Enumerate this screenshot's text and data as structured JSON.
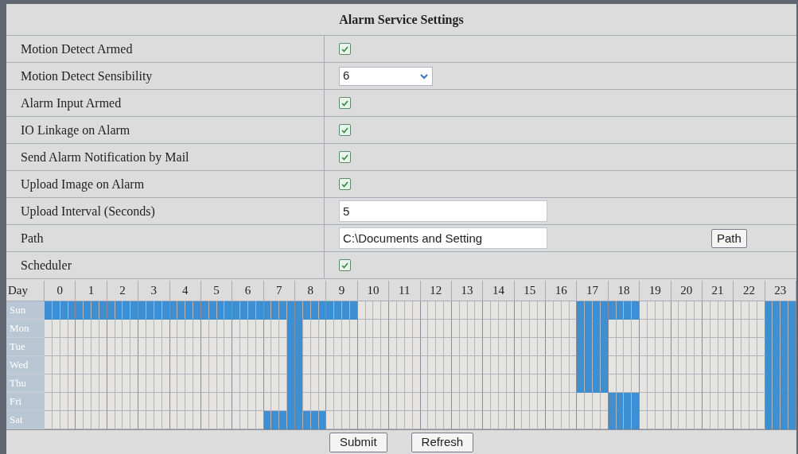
{
  "title": "Alarm Service Settings",
  "settings": [
    {
      "label": "Motion Detect Armed",
      "kind": "checkbox",
      "checked": true
    },
    {
      "label": "Motion Detect Sensibility",
      "kind": "select",
      "value": "6"
    },
    {
      "label": "Alarm Input Armed",
      "kind": "checkbox",
      "checked": true
    },
    {
      "label": "IO Linkage on Alarm",
      "kind": "checkbox",
      "checked": true
    },
    {
      "label": "Send Alarm Notification by Mail",
      "kind": "checkbox",
      "checked": true
    },
    {
      "label": "Upload Image on Alarm",
      "kind": "checkbox",
      "checked": true
    },
    {
      "label": "Upload Interval (Seconds)",
      "kind": "text",
      "value": "5"
    },
    {
      "label": "Path",
      "kind": "path",
      "value": "C:\\Documents and Setting",
      "button": "Path"
    },
    {
      "label": "Scheduler",
      "kind": "checkbox",
      "checked": true
    }
  ],
  "schedule": {
    "day_header": "Day",
    "hours": [
      "0",
      "1",
      "2",
      "3",
      "4",
      "5",
      "6",
      "7",
      "8",
      "9",
      "10",
      "11",
      "12",
      "13",
      "14",
      "15",
      "16",
      "17",
      "18",
      "19",
      "20",
      "21",
      "22",
      "23"
    ],
    "days": [
      {
        "label": "Sun",
        "slots": [
          true,
          true,
          true,
          true,
          true,
          true,
          true,
          true,
          true,
          true,
          true,
          true,
          true,
          true,
          true,
          true,
          true,
          true,
          true,
          true,
          true,
          true,
          true,
          true,
          true,
          true,
          true,
          true,
          true,
          true,
          true,
          true,
          true,
          true,
          true,
          true,
          true,
          true,
          true,
          true,
          false,
          false,
          false,
          false,
          false,
          false,
          false,
          false,
          false,
          false,
          false,
          false,
          false,
          false,
          false,
          false,
          false,
          false,
          false,
          false,
          false,
          false,
          false,
          false,
          false,
          false,
          false,
          false,
          true,
          true,
          true,
          true,
          true,
          true,
          true,
          true,
          false,
          false,
          false,
          false,
          false,
          false,
          false,
          false,
          false,
          false,
          false,
          false,
          false,
          false,
          false,
          false,
          true,
          true,
          true,
          true
        ]
      },
      {
        "label": "Mon",
        "slots": [
          false,
          false,
          false,
          false,
          false,
          false,
          false,
          false,
          false,
          false,
          false,
          false,
          false,
          false,
          false,
          false,
          false,
          false,
          false,
          false,
          false,
          false,
          false,
          false,
          false,
          false,
          false,
          false,
          false,
          false,
          false,
          true,
          true,
          false,
          false,
          false,
          false,
          false,
          false,
          false,
          false,
          false,
          false,
          false,
          false,
          false,
          false,
          false,
          false,
          false,
          false,
          false,
          false,
          false,
          false,
          false,
          false,
          false,
          false,
          false,
          false,
          false,
          false,
          false,
          false,
          false,
          false,
          false,
          true,
          true,
          true,
          true,
          false,
          false,
          false,
          false,
          false,
          false,
          false,
          false,
          false,
          false,
          false,
          false,
          false,
          false,
          false,
          false,
          false,
          false,
          false,
          false,
          true,
          true,
          true,
          true
        ]
      },
      {
        "label": "Tue",
        "slots": [
          false,
          false,
          false,
          false,
          false,
          false,
          false,
          false,
          false,
          false,
          false,
          false,
          false,
          false,
          false,
          false,
          false,
          false,
          false,
          false,
          false,
          false,
          false,
          false,
          false,
          false,
          false,
          false,
          false,
          false,
          false,
          true,
          true,
          false,
          false,
          false,
          false,
          false,
          false,
          false,
          false,
          false,
          false,
          false,
          false,
          false,
          false,
          false,
          false,
          false,
          false,
          false,
          false,
          false,
          false,
          false,
          false,
          false,
          false,
          false,
          false,
          false,
          false,
          false,
          false,
          false,
          false,
          false,
          true,
          true,
          true,
          true,
          false,
          false,
          false,
          false,
          false,
          false,
          false,
          false,
          false,
          false,
          false,
          false,
          false,
          false,
          false,
          false,
          false,
          false,
          false,
          false,
          true,
          true,
          true,
          true
        ]
      },
      {
        "label": "Wed",
        "slots": [
          false,
          false,
          false,
          false,
          false,
          false,
          false,
          false,
          false,
          false,
          false,
          false,
          false,
          false,
          false,
          false,
          false,
          false,
          false,
          false,
          false,
          false,
          false,
          false,
          false,
          false,
          false,
          false,
          false,
          false,
          false,
          true,
          true,
          false,
          false,
          false,
          false,
          false,
          false,
          false,
          false,
          false,
          false,
          false,
          false,
          false,
          false,
          false,
          false,
          false,
          false,
          false,
          false,
          false,
          false,
          false,
          false,
          false,
          false,
          false,
          false,
          false,
          false,
          false,
          false,
          false,
          false,
          false,
          true,
          true,
          true,
          true,
          false,
          false,
          false,
          false,
          false,
          false,
          false,
          false,
          false,
          false,
          false,
          false,
          false,
          false,
          false,
          false,
          false,
          false,
          false,
          false,
          true,
          true,
          true,
          true
        ]
      },
      {
        "label": "Thu",
        "slots": [
          false,
          false,
          false,
          false,
          false,
          false,
          false,
          false,
          false,
          false,
          false,
          false,
          false,
          false,
          false,
          false,
          false,
          false,
          false,
          false,
          false,
          false,
          false,
          false,
          false,
          false,
          false,
          false,
          false,
          false,
          false,
          true,
          true,
          false,
          false,
          false,
          false,
          false,
          false,
          false,
          false,
          false,
          false,
          false,
          false,
          false,
          false,
          false,
          false,
          false,
          false,
          false,
          false,
          false,
          false,
          false,
          false,
          false,
          false,
          false,
          false,
          false,
          false,
          false,
          false,
          false,
          false,
          false,
          true,
          true,
          true,
          true,
          false,
          false,
          false,
          false,
          false,
          false,
          false,
          false,
          false,
          false,
          false,
          false,
          false,
          false,
          false,
          false,
          false,
          false,
          false,
          false,
          true,
          true,
          true,
          true
        ]
      },
      {
        "label": "Fri",
        "slots": [
          false,
          false,
          false,
          false,
          false,
          false,
          false,
          false,
          false,
          false,
          false,
          false,
          false,
          false,
          false,
          false,
          false,
          false,
          false,
          false,
          false,
          false,
          false,
          false,
          false,
          false,
          false,
          false,
          false,
          false,
          false,
          true,
          true,
          false,
          false,
          false,
          false,
          false,
          false,
          false,
          false,
          false,
          false,
          false,
          false,
          false,
          false,
          false,
          false,
          false,
          false,
          false,
          false,
          false,
          false,
          false,
          false,
          false,
          false,
          false,
          false,
          false,
          false,
          false,
          false,
          false,
          false,
          false,
          false,
          false,
          false,
          false,
          true,
          true,
          true,
          true,
          false,
          false,
          false,
          false,
          false,
          false,
          false,
          false,
          false,
          false,
          false,
          false,
          false,
          false,
          false,
          false,
          true,
          true,
          true,
          true
        ]
      },
      {
        "label": "Sat",
        "slots": [
          false,
          false,
          false,
          false,
          false,
          false,
          false,
          false,
          false,
          false,
          false,
          false,
          false,
          false,
          false,
          false,
          false,
          false,
          false,
          false,
          false,
          false,
          false,
          false,
          false,
          false,
          false,
          false,
          true,
          true,
          true,
          true,
          true,
          true,
          true,
          true,
          false,
          false,
          false,
          false,
          false,
          false,
          false,
          false,
          false,
          false,
          false,
          false,
          false,
          false,
          false,
          false,
          false,
          false,
          false,
          false,
          false,
          false,
          false,
          false,
          false,
          false,
          false,
          false,
          false,
          false,
          false,
          false,
          false,
          false,
          false,
          false,
          true,
          true,
          true,
          true,
          false,
          false,
          false,
          false,
          false,
          false,
          false,
          false,
          false,
          false,
          false,
          false,
          false,
          false,
          false,
          false,
          true,
          true,
          true,
          true
        ]
      }
    ]
  },
  "buttons": [
    "Submit",
    "Refresh"
  ]
}
